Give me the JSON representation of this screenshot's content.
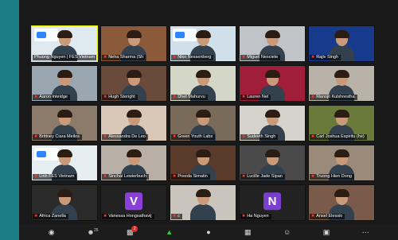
{
  "window": {
    "theme": "zoom gallery view"
  },
  "participants": [
    {
      "name": "Phuong Nguyen | FES Vietnam",
      "muted": false,
      "active_speaker": true,
      "bg": "#dfe9f0",
      "avatar": "video"
    },
    {
      "name": "Neha Sharma (Sh",
      "muted": true,
      "bg": "#8a5a3a",
      "avatar": "video"
    },
    {
      "name": "Niko Nessenberg",
      "muted": true,
      "bg": "#cfe0ea",
      "avatar": "video"
    },
    {
      "name": "Miguel Nesciete",
      "muted": true,
      "bg": "#c0c4c8",
      "avatar": "video"
    },
    {
      "name": "Rajiv Singh",
      "muted": true,
      "bg": "#173a8c",
      "avatar": "video"
    },
    {
      "name": "Aaron Inteidge",
      "muted": true,
      "bg": "#9aa6b0",
      "avatar": "video"
    },
    {
      "name": "Hugh Steright",
      "muted": true,
      "bg": "#6a4a3a",
      "avatar": "video"
    },
    {
      "name": "Dhet Mahurvu",
      "muted": true,
      "bg": "#d4d6c8",
      "avatar": "video"
    },
    {
      "name": "Lauren Nel",
      "muted": true,
      "bg": "#a01e3a",
      "avatar": "video"
    },
    {
      "name": "Manojit Kulshrestha",
      "muted": true,
      "bg": "#b9b2a8",
      "avatar": "video"
    },
    {
      "name": "Brittney Ciara Meilos",
      "muted": true,
      "bg": "#8c7a6a",
      "avatar": "video"
    },
    {
      "name": "Alessandra De Leo",
      "muted": true,
      "bg": "#d9c8b8",
      "avatar": "video"
    },
    {
      "name": "Green Youth Labs",
      "muted": true,
      "bg": "#7a6a5a",
      "avatar": "video"
    },
    {
      "name": "Sudeeth Singh",
      "muted": true,
      "bg": "#d6d2cc",
      "avatar": "video"
    },
    {
      "name": "Carl Joshua Espiritu (he)",
      "muted": true,
      "bg": "#6a7a3a",
      "avatar": "video"
    },
    {
      "name": "Linh FES Vietnam",
      "muted": true,
      "bg": "#e6eef2",
      "avatar": "video"
    },
    {
      "name": "Sinchai Lewierbuch",
      "muted": true,
      "bg": "#b8b0a6",
      "avatar": "video"
    },
    {
      "name": "Preeda Simatin",
      "muted": true,
      "bg": "#5a3a2a",
      "avatar": "video"
    },
    {
      "name": "Lucille Jade Sipan",
      "muted": true,
      "bg": "#4a4a4a",
      "avatar": "video"
    },
    {
      "name": "Truong Hien Dong",
      "muted": true,
      "bg": "#9a8a7a",
      "avatar": "video"
    },
    {
      "name": "Africa Zanella",
      "muted": true,
      "bg": "#2a2a2a",
      "avatar": "video"
    },
    {
      "name": "Vanessa Hongsathavij",
      "muted": true,
      "bg": "#222222",
      "avatar": "letter",
      "letter": "V",
      "letter_color": "#8a3fd8"
    },
    {
      "name": "c",
      "muted": true,
      "bg": "#c9c4bc",
      "avatar": "video"
    },
    {
      "name": "Ha Nguyen",
      "muted": true,
      "bg": "#222222",
      "avatar": "letter",
      "letter": "N",
      "letter_color": "#7b3fd0"
    },
    {
      "name": "Ansel Elessio",
      "muted": true,
      "bg": "#7a5a4a",
      "avatar": "video"
    }
  ],
  "toolbar": {
    "participants_count": "25",
    "chat_badge": "2",
    "icons": [
      "security-icon",
      "participants-icon",
      "chat-icon",
      "share-screen-icon",
      "record-icon",
      "breakout-icon",
      "reactions-icon",
      "apps-icon",
      "more-icon"
    ]
  }
}
